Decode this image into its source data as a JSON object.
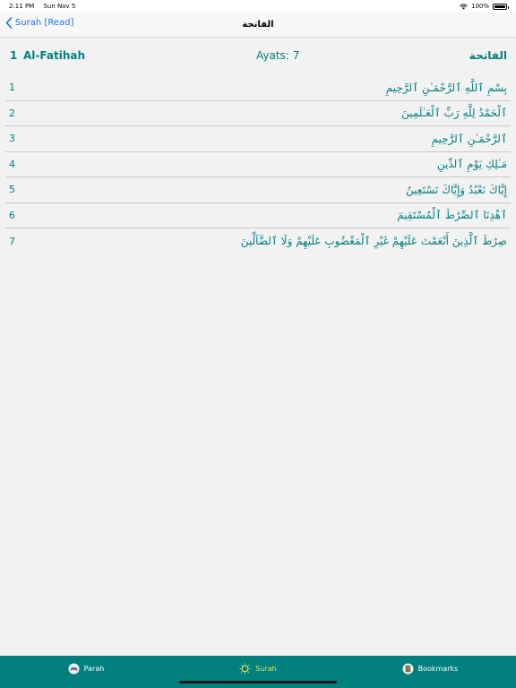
{
  "status": {
    "time": "2:11 PM",
    "date": "Sun Nov 5",
    "battery": "100%",
    "battery_level": 1.0
  },
  "nav": {
    "back_label": "Surah [Read]",
    "title": "الفاتحة"
  },
  "surah": {
    "number": "1",
    "name": "Al-Fatihah",
    "ayats": "Ayats: 7",
    "arabic_name": "الفاتحة"
  },
  "ayahs": [
    {
      "number": "1",
      "text": "بِسْمِ ٱللَّهِ ٱلرَّحْمَـٰنِ ٱلرَّحِيمِ"
    },
    {
      "number": "2",
      "text": "ٱلْحَمْدُ لِلَّهِ رَبِّ ٱلْعَـٰلَمِينَ"
    },
    {
      "number": "3",
      "text": "ٱلرَّحْمَـٰنِ ٱلرَّحِيمِ"
    },
    {
      "number": "4",
      "text": "مَـٰلِكِ يَوْمِ ٱلدِّينِ"
    },
    {
      "number": "5",
      "text": "إِيَّاكَ نَعْبُدُ وَإِيَّاكَ نَسْتَعِينُ"
    },
    {
      "number": "6",
      "text": "ٱهْدِنَا ٱلصِّرَٰطَ ٱلْمُسْتَقِيمَ"
    },
    {
      "number": "7",
      "text": "صِرَٰطَ ٱلَّذِينَ أَنْعَمْتَ عَلَيْهِمْ غَيْرِ ٱلْمَغْضُوبِ عَلَيْهِمْ وَلَا ٱلضَّآلِّينَ"
    }
  ],
  "tabs": [
    {
      "label": "Parah",
      "icon": "book-icon"
    },
    {
      "label": "Surah",
      "icon": "sun-icon"
    },
    {
      "label": "Bookmarks",
      "icon": "bookmark-icon"
    }
  ],
  "colors": {
    "accent": "#008080",
    "tab_bar": "#00807d",
    "active_tab": "#f5e04a",
    "link": "#1a73e8"
  }
}
